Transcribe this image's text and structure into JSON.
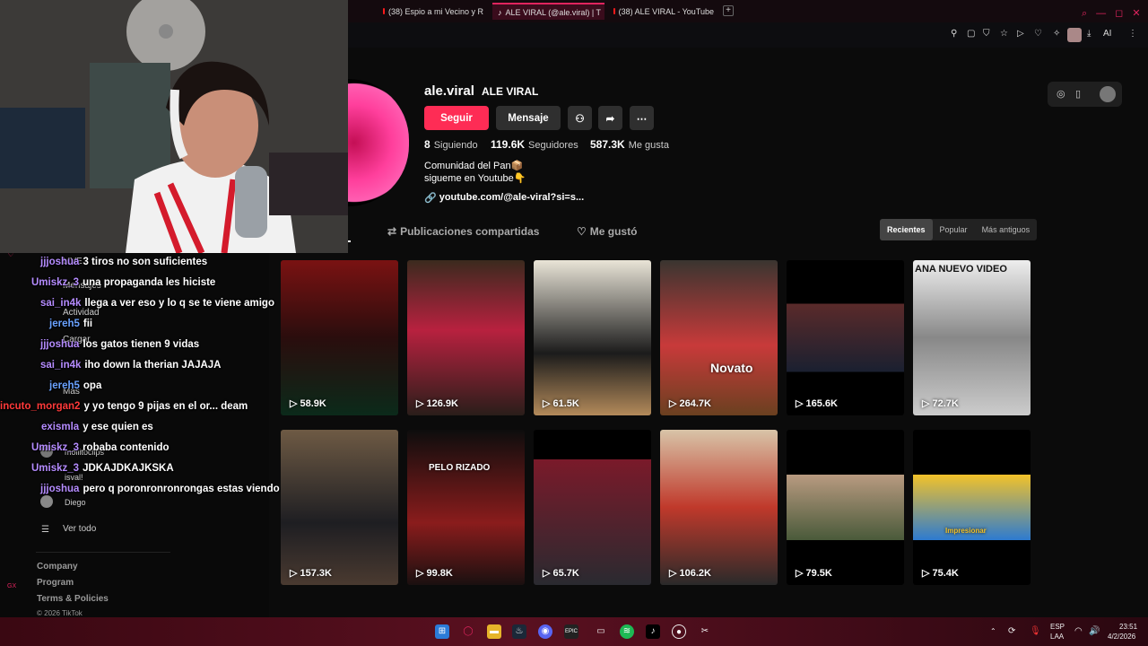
{
  "browser": {
    "tabs": [
      {
        "label": "(38) Espio a mi Vecino y R",
        "active": false,
        "icon": "youtube-icon"
      },
      {
        "label": "ALE VIRAL (@ale.viral) | T",
        "active": true,
        "icon": "tiktok-icon"
      },
      {
        "label": "(38) ALE VIRAL - YouTube",
        "active": false,
        "icon": "youtube-icon"
      }
    ],
    "new_tab": "+",
    "toolbar_ai": "AI"
  },
  "profile": {
    "username": "ale.viral",
    "display_name": "ALE VIRAL",
    "follow_label": "Seguir",
    "message_label": "Mensaje",
    "following_count": "8",
    "following_label": "Siguiendo",
    "followers_count": "119.6K",
    "followers_label": "Seguidores",
    "likes_count": "587.3K",
    "likes_label": "Me gusta",
    "bio_line1": "Comunidad del Pan📦",
    "bio_line2": "sigueme en Youtube👇",
    "link": "youtube.com/@ale-viral?si=s..."
  },
  "tabs": {
    "shared": "Publicaciones compartidas",
    "liked": "Me gustó"
  },
  "sort": {
    "recent": "Recientes",
    "popular": "Popular",
    "oldest": "Más antiguos"
  },
  "videos": [
    {
      "views": "58.9K"
    },
    {
      "views": "126.9K"
    },
    {
      "views": "61.5K"
    },
    {
      "views": "264.7K",
      "caption": "Novato"
    },
    {
      "views": "165.6K"
    },
    {
      "views": "72.7K",
      "caption": "ANA NUEVO VIDEO"
    },
    {
      "views": "157.3K"
    },
    {
      "views": "99.8K",
      "caption": "PELO RIZADO"
    },
    {
      "views": "65.7K"
    },
    {
      "views": "106.2K"
    },
    {
      "views": "79.5K"
    },
    {
      "views": "75.4K",
      "caption": "Impresionar"
    }
  ],
  "sidebar": {
    "live": "LIVE",
    "messages": "Mensajes",
    "activity": "Actividad",
    "upload": "Cargar",
    "more": "Más",
    "followed_1": "mollitoclips",
    "followed_2": "isval!",
    "followed_3": "Diego",
    "see_all": "Ver todo",
    "company": "Company",
    "program": "Program",
    "terms": "Terms & Policies",
    "copyright": "© 2026 TikTok"
  },
  "chat": [
    {
      "user": "jjjoshua",
      "msg": "3 tiros no son suficientes",
      "color": "#b58cff"
    },
    {
      "user": "Umiskz_3",
      "msg": "una propaganda les hiciste",
      "color": "#b58cff"
    },
    {
      "user": "sai_in4k",
      "msg": "llega a ver eso y lo q se te viene amigo",
      "color": "#b58cff"
    },
    {
      "user": "jereh5",
      "msg": "fii",
      "color": "#6aa2ff"
    },
    {
      "user": "jjjoshua",
      "msg": "los gatos tienen 9 vidas",
      "color": "#b58cff"
    },
    {
      "user": "sai_in4k",
      "msg": "iho down la therian JAJAJA",
      "color": "#b58cff"
    },
    {
      "user": "jereh5",
      "msg": "opa",
      "color": "#6aa2ff"
    },
    {
      "user": "incuto_morgan2",
      "msg": "y yo tengo 9 pijas en el or... deam",
      "color": "#ff3a3a"
    },
    {
      "user": "exismla",
      "msg": "y ese quien es",
      "color": "#b58cff"
    },
    {
      "user": "Umiskz_3",
      "msg": "robaba contenido",
      "color": "#b58cff"
    },
    {
      "user": "Umiskz_3",
      "msg": "JDKAJDKAJKSKA",
      "color": "#b58cff"
    },
    {
      "user": "jjjoshua",
      "msg": "pero q poronronronrongas estas viendo",
      "color": "#b58cff"
    }
  ],
  "tray": {
    "lang1": "ESP",
    "lang2": "LAA",
    "time": "23:51",
    "date": "4/2/2026"
  },
  "colors": {
    "accent": "#fe2c55",
    "browser_accent": "#e0245e"
  }
}
